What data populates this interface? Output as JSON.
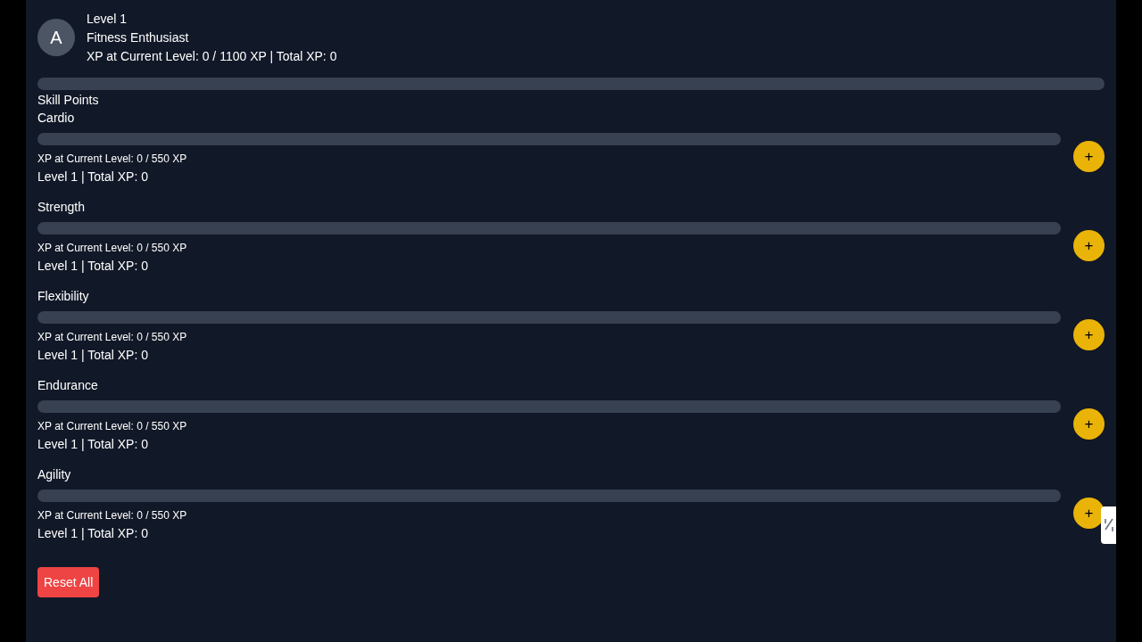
{
  "profile": {
    "avatar_initial": "A",
    "level_text": "Level 1",
    "title": "Fitness Enthusiast",
    "xp_summary": "XP at Current Level: 0 / 1100 XP | Total XP: 0"
  },
  "skills_heading": "Skill Points",
  "skills": [
    {
      "name": "Cardio",
      "xp": "XP at Current Level: 0 / 550 XP",
      "summary": "Level 1 | Total XP: 0",
      "add_button": "+"
    },
    {
      "name": "Strength",
      "xp": "XP at Current Level: 0 / 550 XP",
      "summary": "Level 1 | Total XP: 0",
      "add_button": "+"
    },
    {
      "name": "Flexibility",
      "xp": "XP at Current Level: 0 / 550 XP",
      "summary": "Level 1 | Total XP: 0",
      "add_button": "+"
    },
    {
      "name": "Endurance",
      "xp": "XP at Current Level: 0 / 550 XP",
      "summary": "Level 1 | Total XP: 0",
      "add_button": "+"
    },
    {
      "name": "Agility",
      "xp": "XP at Current Level: 0 / 550 XP",
      "summary": "Level 1 | Total XP: 0",
      "add_button": "+"
    }
  ],
  "reset_button": "Reset All"
}
